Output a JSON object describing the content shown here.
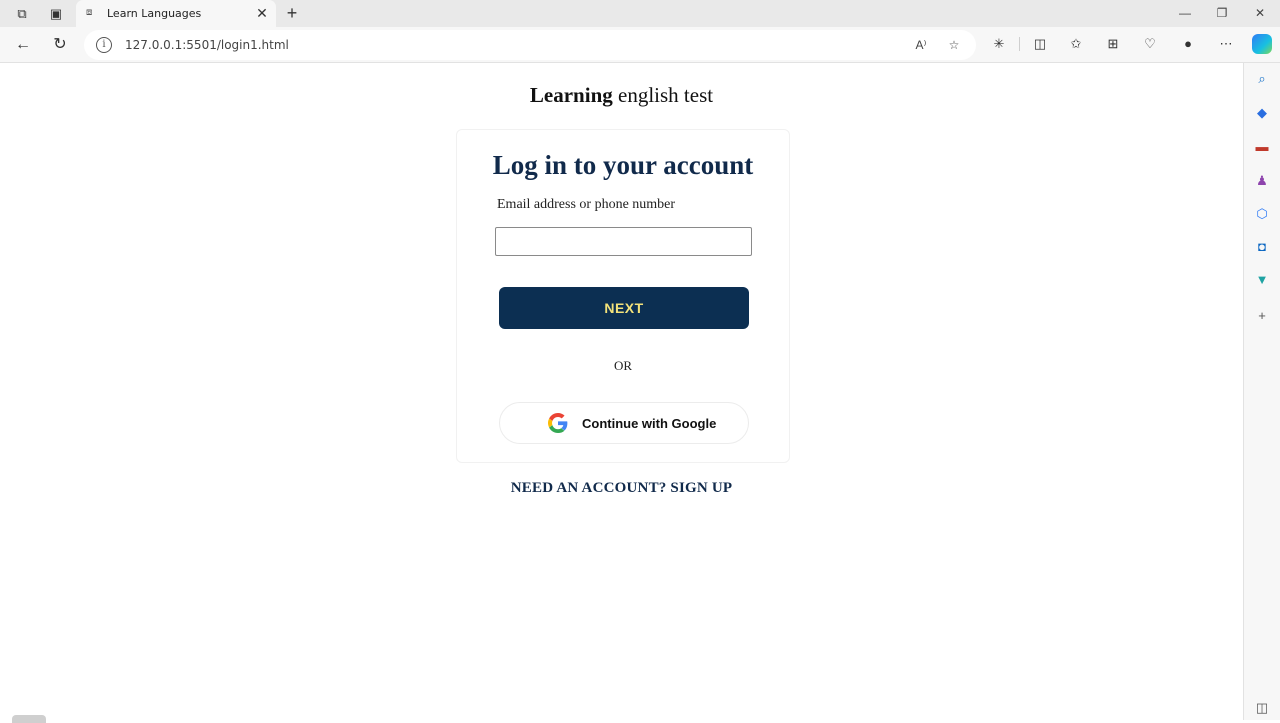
{
  "browser": {
    "tab_title": "Learn Languages",
    "tab_close_glyph": "✕",
    "new_tab_glyph": "+",
    "url": "127.0.0.1:5501/login1.html",
    "window_controls": {
      "minimize": "—",
      "maximize": "❐",
      "close": "✕"
    },
    "toolbar_icons": [
      "read-aloud-icon",
      "favorite-star-icon",
      "extensions-icon",
      "split-screen-icon",
      "favorites-icon",
      "collections-icon",
      "browser-essentials-icon",
      "profile-icon",
      "more-icon",
      "copilot-icon"
    ],
    "sidebar_icons": [
      "search-icon",
      "shopping-icon",
      "tools-icon",
      "games-icon",
      "microsoft365-icon",
      "outlook-icon",
      "drop-icon",
      "add-icon"
    ]
  },
  "page": {
    "site_title_bold": "Learning",
    "site_title_rest": " english test",
    "heading": "Log in to your account",
    "email_label": "Email address or phone number",
    "email_value": "",
    "next_label": "NEXT",
    "or_label": "OR",
    "google_label": "Continue with Google",
    "signup_label": "NEED AN ACCOUNT? SIGN UP"
  },
  "colors": {
    "heading": "#112a4b",
    "next_button_bg": "#0c2f52",
    "next_button_text": "#f3e27a"
  }
}
